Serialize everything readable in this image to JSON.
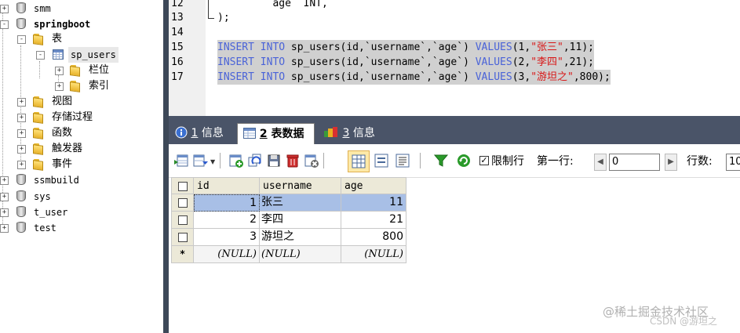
{
  "tree": {
    "items": [
      {
        "label": "smm",
        "expander": "+"
      },
      {
        "label": "springboot",
        "expander": "-"
      },
      {
        "label": "表",
        "expander": "-"
      },
      {
        "label": "sp_users",
        "expander": "-"
      },
      {
        "label": "栏位",
        "expander": "+"
      },
      {
        "label": "索引",
        "expander": "+"
      },
      {
        "label": "视图",
        "expander": "+"
      },
      {
        "label": "存储过程",
        "expander": "+"
      },
      {
        "label": "函数",
        "expander": "+"
      },
      {
        "label": "触发器",
        "expander": "+"
      },
      {
        "label": "事件",
        "expander": "+"
      },
      {
        "label": "ssmbuild",
        "expander": "+"
      },
      {
        "label": "sys",
        "expander": "+"
      },
      {
        "label": "t_user",
        "expander": "+"
      },
      {
        "label": "test",
        "expander": "+"
      }
    ]
  },
  "editor": {
    "lines": [
      {
        "no": "12",
        "prefix": "        `age` INT,"
      },
      {
        "no": "13",
        "prefix": ");"
      },
      {
        "no": "14",
        "prefix": ""
      },
      {
        "no": "15",
        "kw1": "INSERT INTO",
        "mid": " sp_users(id,`username`,`age`) ",
        "kw2": "VALUES",
        "open": "(1,",
        "str": "\"张三\"",
        "close": ",11);"
      },
      {
        "no": "16",
        "kw1": "INSERT INTO",
        "mid": " sp_users(id,`username`,`age`) ",
        "kw2": "VALUES",
        "open": "(2,",
        "str": "\"李四\"",
        "close": ",21);"
      },
      {
        "no": "17",
        "kw1": "INSERT INTO",
        "mid": " sp_users(id,`username`,`age`) ",
        "kw2": "VALUES",
        "open": "(3,",
        "str": "\"游坦之\"",
        "close": ",800);"
      }
    ]
  },
  "tabs": [
    {
      "num": "1",
      "label": " 信息"
    },
    {
      "num": "2",
      "label": " 表数据"
    },
    {
      "num": "3",
      "label": " 信息"
    }
  ],
  "toolbar": {
    "limit_label": "限制行",
    "first_row_label": "第一行:",
    "first_row_value": "0",
    "row_count_label": "行数:",
    "row_count_value": "10",
    "limit_checked": "✓"
  },
  "grid": {
    "columns": [
      "id",
      "username",
      "age"
    ],
    "rows": [
      [
        "1",
        "张三",
        "11"
      ],
      [
        "2",
        "李四",
        "21"
      ],
      [
        "3",
        "游坦之",
        "800"
      ]
    ],
    "new_row": [
      "(NULL)",
      "(NULL)",
      "(NULL)"
    ],
    "new_row_marker": "*"
  },
  "watermark": {
    "line1": "@稀土掘金技术社区",
    "line2": "CSDN @游坦之"
  },
  "colors": {
    "keyword": "#4a63d8",
    "string": "#d81818",
    "selection": "#d0d0d0",
    "tabbar": "#4a5468",
    "grid_selected": "#a8bfe6"
  }
}
